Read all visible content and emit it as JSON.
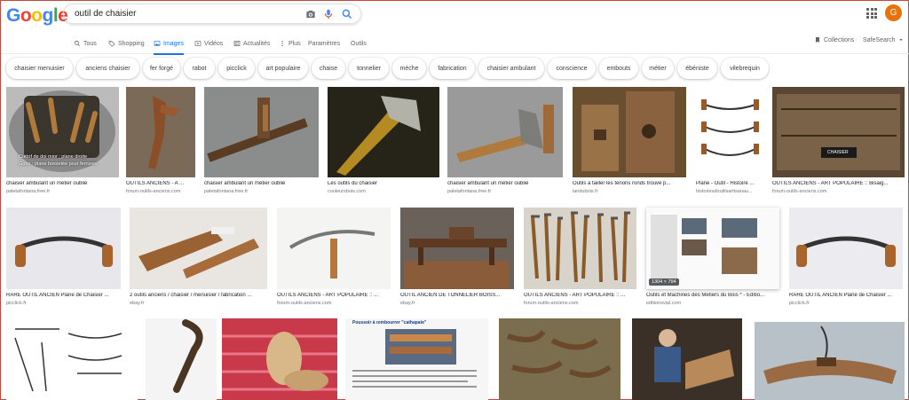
{
  "header": {
    "logo_letters": [
      {
        "ch": "G",
        "color": "#4285f4"
      },
      {
        "ch": "o",
        "color": "#ea4335"
      },
      {
        "ch": "o",
        "color": "#fbbc05"
      },
      {
        "ch": "g",
        "color": "#4285f4"
      },
      {
        "ch": "l",
        "color": "#34a853"
      },
      {
        "ch": "e",
        "color": "#ea4335"
      }
    ],
    "search_value": "outil de chaisier",
    "avatar_letter": "G",
    "avatar_color": "#e8710a"
  },
  "tabs": {
    "all": "Tous",
    "shopping": "Shopping",
    "images": "Images",
    "videos": "Vidéos",
    "news": "Actualités",
    "more": "Plus",
    "settings": "Paramètres",
    "tools": "Outils"
  },
  "right_tools": {
    "collections": "Collections",
    "safesearch": "SafeSearch"
  },
  "chips": [
    "chaisier menuisier",
    "anciens chaisier",
    "fer forgé",
    "rabot",
    "picclick",
    "art populaire",
    "chaise",
    "tonnelier",
    "mèche",
    "fabrication",
    "chaisier ambulant",
    "conscience",
    "embouts",
    "métier",
    "ébéniste",
    "vilebrequin"
  ],
  "results": [
    {
      "caption": "chaisier ambulant un métier oublié",
      "source": "paletafontana.free.fr",
      "overlay": [
        "Cortof de doi mior ; plane droite",
        "Gobo ; plane bosselée pour ferrures"
      ]
    },
    {
      "caption": "OUTILS ANCIENS - A ...",
      "source": "forum-outils-anciens.com"
    },
    {
      "caption": "chaisier ambulant un métier oublié",
      "source": "paletafontana.free.fr"
    },
    {
      "caption": "Les outils du chaisier",
      "source": "couleursbois.com"
    },
    {
      "caption": "chaisier ambulant un métier oublié",
      "source": "paletafontana.free.fr"
    },
    {
      "caption": "Outils à tailler les tenons ronds trouvé p...",
      "source": "lairdubois.fr"
    },
    {
      "caption": "Plane - Outil - Histoire ...",
      "source": "histoiresdoutilsartisanau..."
    },
    {
      "caption": "OUTILS ANCIENS - ART POPULAIRE :: Bisaig...",
      "source": "forum-outils-anciens.com",
      "overlay": [
        "CHAISIER"
      ]
    },
    {
      "caption": "RARE OUTIL ANCIEN Plane de Chaisier ...",
      "source": "picclick.fr"
    },
    {
      "caption": "2 outils anciens / chaisier / menuisier / fabrication ...",
      "source": "ebay.fr"
    },
    {
      "caption": "OUTILS ANCIENS - ART POPULAIRE :: ...",
      "source": "forum-outils-anciens.com"
    },
    {
      "caption": "OUTIL ANCIEN DE TONNELIER BOISS...",
      "source": "ebay.fr"
    },
    {
      "caption": "OUTILS ANCIENS - ART POPULAIRE :: ...",
      "source": "forum-outils-anciens.com"
    },
    {
      "caption": "Outils et Machines des Métiers du Bois * - Editio...",
      "source": "editionsvial.com",
      "badge": "1304 × 794"
    },
    {
      "caption": "RARE OUTIL ANCIEN Plane de Chaisier ...",
      "source": "picclick.fr"
    },
    {
      "caption": "",
      "source": ""
    },
    {
      "caption": "",
      "source": ""
    },
    {
      "caption": "",
      "source": ""
    },
    {
      "caption": "",
      "source": "",
      "overlay": [
        "Poussoir à rembourrer \"cathapate\""
      ]
    },
    {
      "caption": "",
      "source": ""
    },
    {
      "caption": "",
      "source": ""
    },
    {
      "caption": "",
      "source": ""
    }
  ]
}
